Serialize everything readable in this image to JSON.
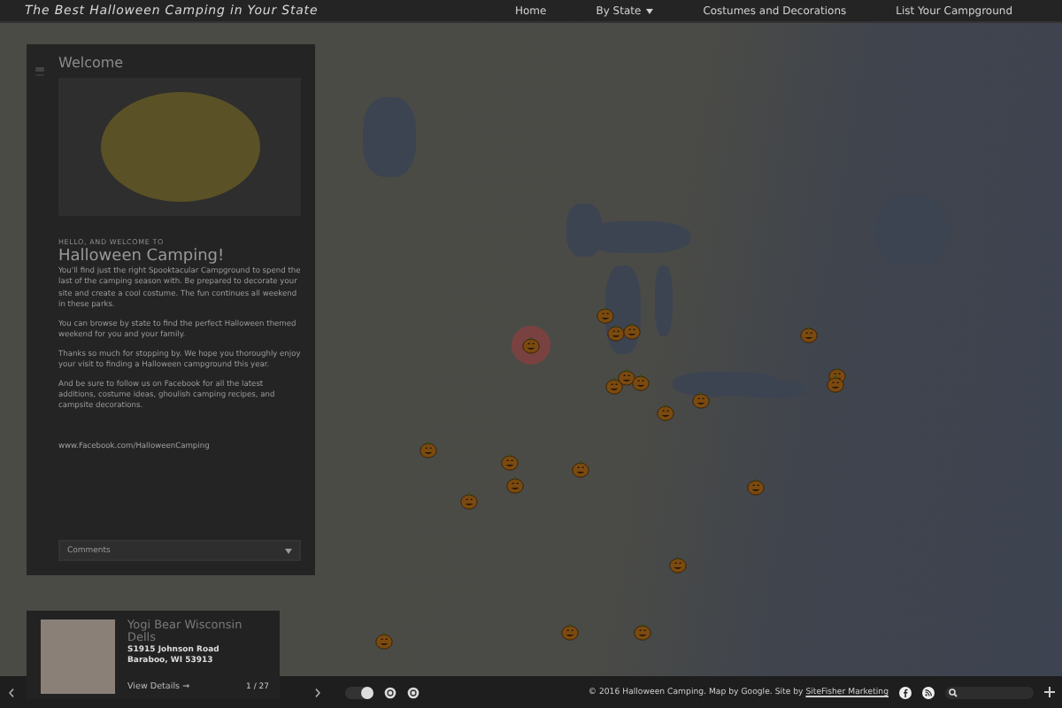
{
  "header": {
    "tagline": "The Best Halloween Camping in Your State",
    "nav": [
      {
        "label": "Home",
        "dropdown": false
      },
      {
        "label": "By State",
        "dropdown": true
      },
      {
        "label": "Costumes and Decorations",
        "dropdown": false
      },
      {
        "label": "List Your Campground",
        "dropdown": false
      }
    ]
  },
  "map": {
    "markers": [
      {
        "selected": false
      },
      {
        "selected": false
      },
      {
        "selected": false
      },
      {
        "selected": true
      },
      {
        "selected": false
      },
      {
        "selected": false
      },
      {
        "selected": false
      },
      {
        "selected": false
      },
      {
        "selected": false
      },
      {
        "selected": false
      },
      {
        "selected": false
      },
      {
        "selected": false
      },
      {
        "selected": false
      },
      {
        "selected": false
      },
      {
        "selected": false
      },
      {
        "selected": false
      },
      {
        "selected": false
      },
      {
        "selected": false
      },
      {
        "selected": false
      },
      {
        "selected": false
      },
      {
        "selected": false
      },
      {
        "selected": false
      }
    ]
  },
  "panel": {
    "title": "Welcome",
    "kicker": "HELLO, AND WELCOME TO",
    "heading": "Halloween Camping!",
    "paragraphs": [
      "You'll find just the right Spooktacular Campground to spend the last of the camping season with. Be prepared to decorate your site and create a cool costume. The fun continues all weekend in these parks.",
      "You can browse by state to find the perfect Halloween themed weekend for you and your family.",
      "Thanks so much for stopping by. We hope you thoroughly enjoy your visit to finding a Halloween campground this year.",
      "And be sure to follow us on Facebook for all the latest additions, costume ideas, ghoulish camping recipes, and campsite decorations."
    ],
    "link": "www.Facebook.com/HalloweenCamping",
    "select": "Comments"
  },
  "card": {
    "name": "Yogi Bear Wisconsin Dells",
    "address": [
      "S1915 Johnson Road",
      "Baraboo, WI 53913"
    ],
    "details": "View Details →",
    "counter": "1 / 27"
  },
  "footer": {
    "credit": "© 2016 Halloween Camping. Map by Google. Site by ",
    "credit_link": "SiteFisher Marketing",
    "toggle": {
      "on": true
    }
  }
}
